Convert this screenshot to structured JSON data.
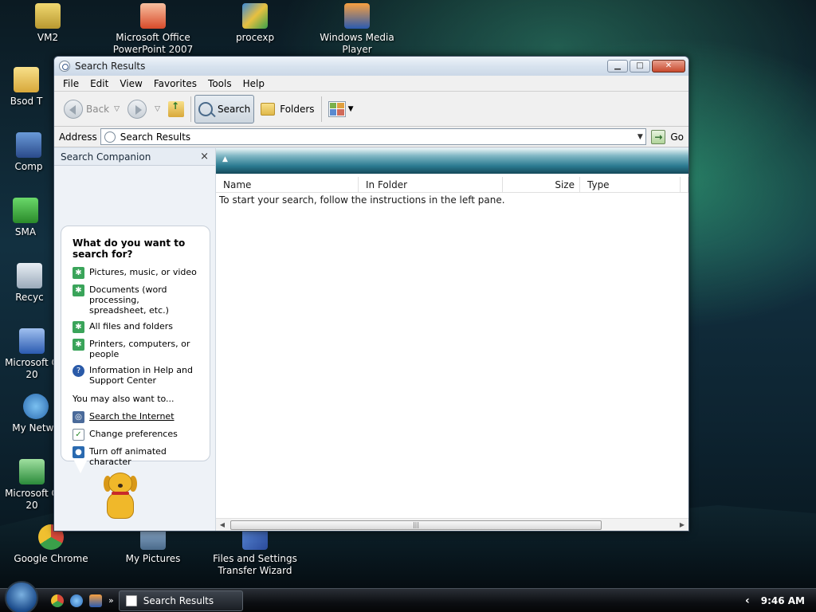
{
  "desktop": {
    "icons": [
      {
        "label": "VM2"
      },
      {
        "label": "Microsoft Office PowerPoint 2007"
      },
      {
        "label": "procexp"
      },
      {
        "label": "Windows Media Player"
      },
      {
        "label": "Bsod T"
      },
      {
        "label": "Comp"
      },
      {
        "label": "SMA"
      },
      {
        "label": "Recyc"
      },
      {
        "label": "Microsoft O 20"
      },
      {
        "label": "My Netwo"
      },
      {
        "label": "Microsoft O 20"
      },
      {
        "label": "Google Chrome"
      },
      {
        "label": "My Pictures"
      },
      {
        "label": "Files and Settings Transfer Wizard"
      }
    ]
  },
  "window": {
    "title": "Search Results",
    "menu": [
      "File",
      "Edit",
      "View",
      "Favorites",
      "Tools",
      "Help"
    ],
    "toolbar": {
      "back_label": "Back",
      "search_label": "Search",
      "folders_label": "Folders"
    },
    "address": {
      "label": "Address",
      "value": "Search Results",
      "go_label": "Go"
    },
    "search_companion": {
      "title": "Search Companion",
      "close_glyph": "×",
      "question": "What do you want to search for?",
      "options": [
        "Pictures, music, or video",
        "Documents (word processing, spreadsheet, etc.)",
        "All files and folders",
        "Printers, computers, or people",
        "Information in Help and Support Center"
      ],
      "also_label": "You may also want to...",
      "also_options": [
        "Search the Internet",
        "Change preferences",
        "Turn off animated character"
      ]
    },
    "results": {
      "columns": [
        "Name",
        "In Folder",
        "Size",
        "Type"
      ],
      "empty_message": "To start your search, follow the instructions in the left pane."
    }
  },
  "taskbar": {
    "task_label": "Search Results",
    "clock": "9:46 AM",
    "quicklaunch_more": "»"
  }
}
